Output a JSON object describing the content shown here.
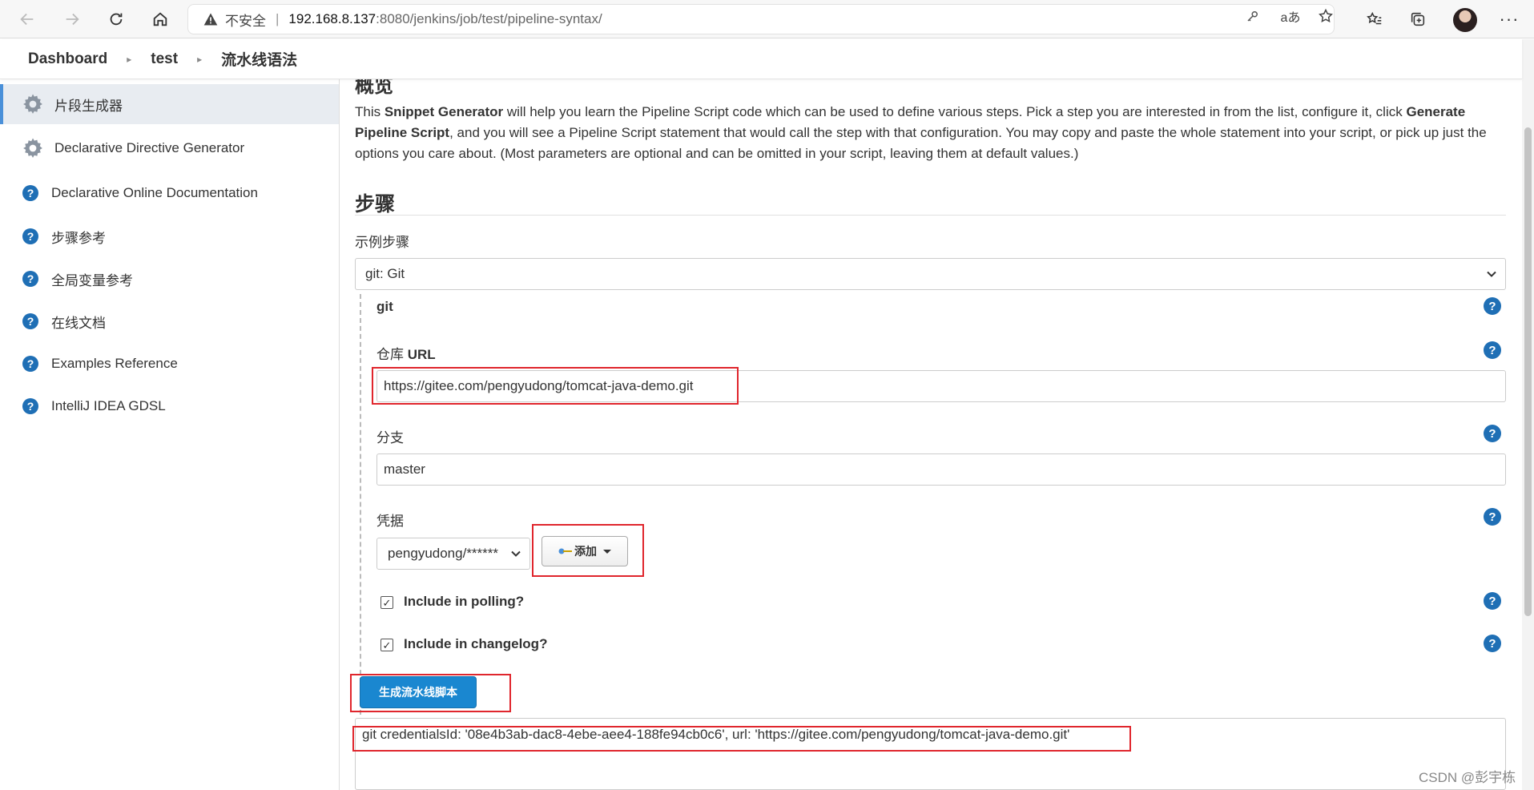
{
  "browser": {
    "insecure_label": "不安全",
    "url_host": "192.168.8.137",
    "url_path": ":8080/jenkins/job/test/pipeline-syntax/"
  },
  "breadcrumb": [
    "Dashboard",
    "test",
    "流水线语法"
  ],
  "sidebar": {
    "items": [
      {
        "label": "片段生成器",
        "icon": "gear-icon",
        "active": true
      },
      {
        "label": "Declarative Directive Generator",
        "icon": "gear-icon"
      },
      {
        "label": "Declarative Online Documentation",
        "icon": "help-icon"
      },
      {
        "label": "步骤参考",
        "icon": "help-icon"
      },
      {
        "label": "全局变量参考",
        "icon": "help-icon"
      },
      {
        "label": "在线文档",
        "icon": "help-icon"
      },
      {
        "label": "Examples Reference",
        "icon": "help-icon"
      },
      {
        "label": "IntelliJ IDEA GDSL",
        "icon": "help-icon"
      }
    ]
  },
  "main": {
    "overview_heading": "概览",
    "description": {
      "p1": "This ",
      "b1": "Snippet Generator",
      "p2": " will help you learn the Pipeline Script code which can be used to define various steps. Pick a step you are interested in from the list, configure it, click ",
      "b2": "Generate Pipeline Script",
      "p3": ", and you will see a Pipeline Script statement that would call the step with that configuration. You may copy and paste the whole statement into your script, or pick up just the options you care about. (Most parameters are optional and can be omitted in your script, leaving them at default values.)"
    },
    "steps_title": "步骤",
    "sample_step_label": "示例步骤",
    "sample_step_value": "git: Git",
    "git_heading": "git",
    "repo_url_label_cn": "仓库 ",
    "repo_url_label_en": "URL",
    "repo_url_value": "https://gitee.com/pengyudong/tomcat-java-demo.git",
    "branch_label": "分支",
    "branch_value": "master",
    "credentials_label": "凭据",
    "credentials_value": "pengyudong/******",
    "add_button": "添加",
    "include_polling": "Include in polling?",
    "include_changelog": "Include in changelog?",
    "generate_button": "生成流水线脚本",
    "output_text": "git credentialsId: '08e4b3ab-dac8-4ebe-aee4-188fe94cb0c6', url: 'https://gitee.com/pengyudong/tomcat-java-demo.git'"
  },
  "watermark": "CSDN @彭宇栋",
  "colors": {
    "accent": "#1a87d0",
    "help_icon": "#1f6fb5",
    "highlight_box": "#e0262d"
  }
}
